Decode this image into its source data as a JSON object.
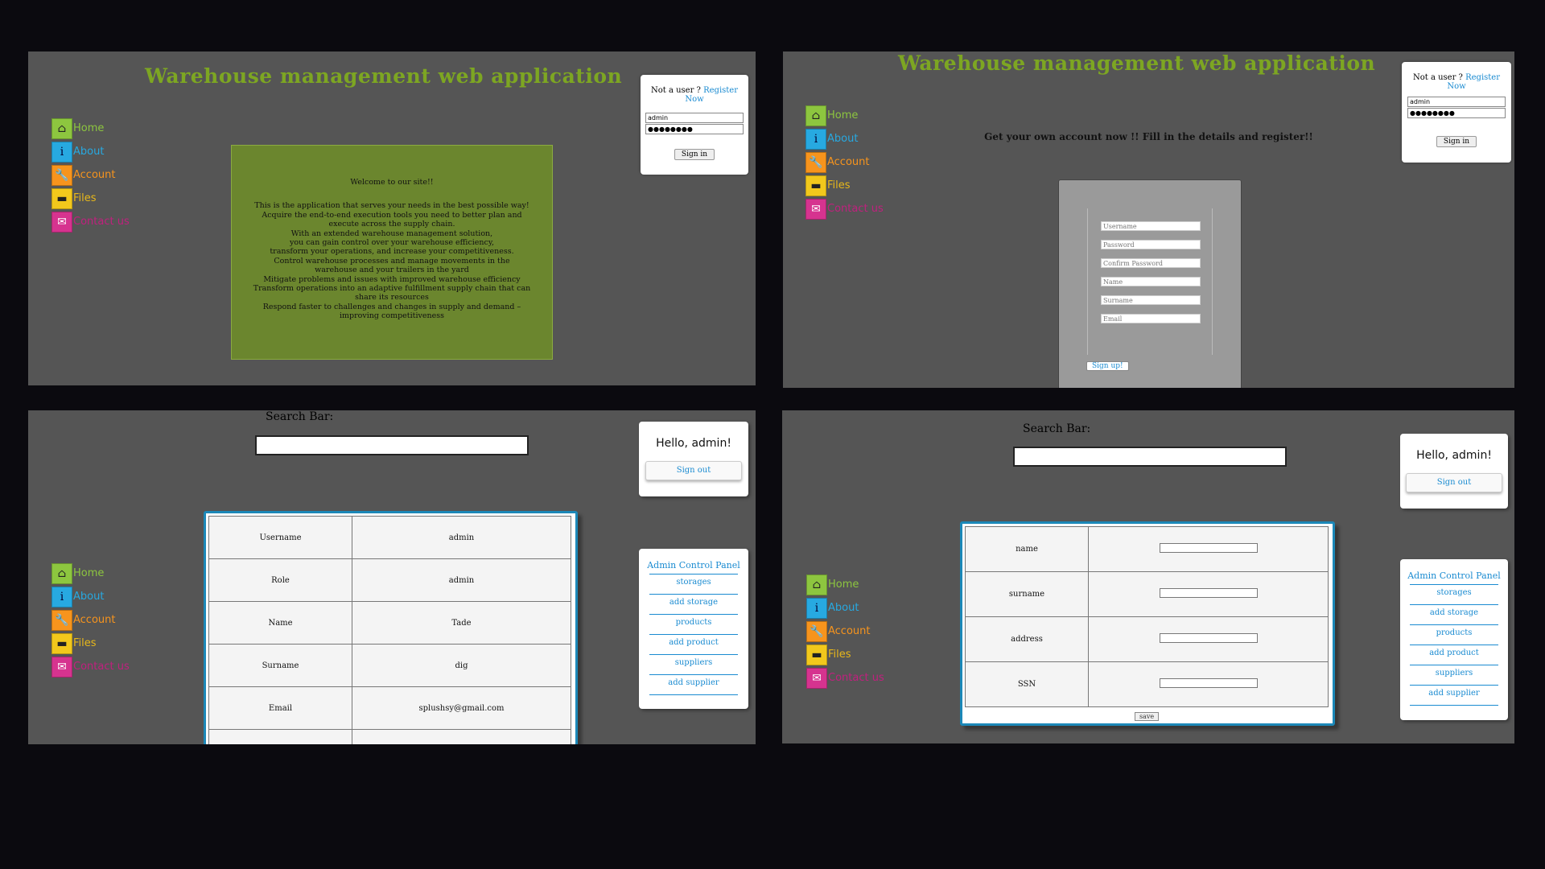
{
  "app_title": "Warehouse management web application",
  "nav": [
    {
      "label": "Home",
      "icon": "home-icon",
      "glyph": "⌂"
    },
    {
      "label": "About",
      "icon": "info-icon",
      "glyph": "i"
    },
    {
      "label": "Account",
      "icon": "wrench-icon",
      "glyph": "🔧"
    },
    {
      "label": "Files",
      "icon": "folder-icon",
      "glyph": "▬"
    },
    {
      "label": "Contact us",
      "icon": "mail-icon",
      "glyph": "✉"
    }
  ],
  "login": {
    "prompt": "Not a user ?",
    "register_link": "Register Now",
    "username_value": "admin",
    "password_value": "●●●●●●●●",
    "password_value_short": "●●●●●●●●",
    "signin_label": "Sign in"
  },
  "welcome": {
    "title": "Welcome to our site!!",
    "lines": [
      "This is the application that serves your needs in the best possible way!",
      "Acquire the end-to-end execution tools you need to better plan and",
      "execute across the supply chain.",
      "With an extended warehouse management solution,",
      "you can gain control over your warehouse efficiency,",
      "transform your operations, and increase your competitiveness.",
      "Control warehouse processes and manage movements in the",
      "warehouse and your trailers in the yard",
      "Mitigate problems and issues with improved warehouse efficiency",
      "Transform operations into an adaptive fulfillment supply chain that can",
      "share its resources",
      "Respond faster to challenges and changes in supply and demand –",
      "improving competitiveness"
    ]
  },
  "register": {
    "message": "Get your own account now !! Fill in the details and register!!",
    "placeholders": {
      "username": "Username",
      "password": "Password",
      "confirm": "Confirm Password",
      "name": "Name",
      "surname": "Surname",
      "email": "Email"
    },
    "signup_label": "Sign up!"
  },
  "search": {
    "label": "Search Bar:"
  },
  "session": {
    "greeting": "Hello, admin!",
    "signout_label": "Sign out"
  },
  "admin_panel": {
    "title": "Admin Control Panel",
    "links": [
      "storages",
      "add storage",
      "products",
      "add product",
      "suppliers",
      "add supplier"
    ]
  },
  "profile": {
    "rows": [
      {
        "key": "Username",
        "value": "admin"
      },
      {
        "key": "Role",
        "value": "admin"
      },
      {
        "key": "Name",
        "value": "Tade"
      },
      {
        "key": "Surname",
        "value": "dig"
      },
      {
        "key": "Email",
        "value": "splushsy@gmail.com"
      }
    ]
  },
  "supplier_form": {
    "fields": [
      "name",
      "surname",
      "address",
      "SSN"
    ],
    "save_label": "save"
  }
}
